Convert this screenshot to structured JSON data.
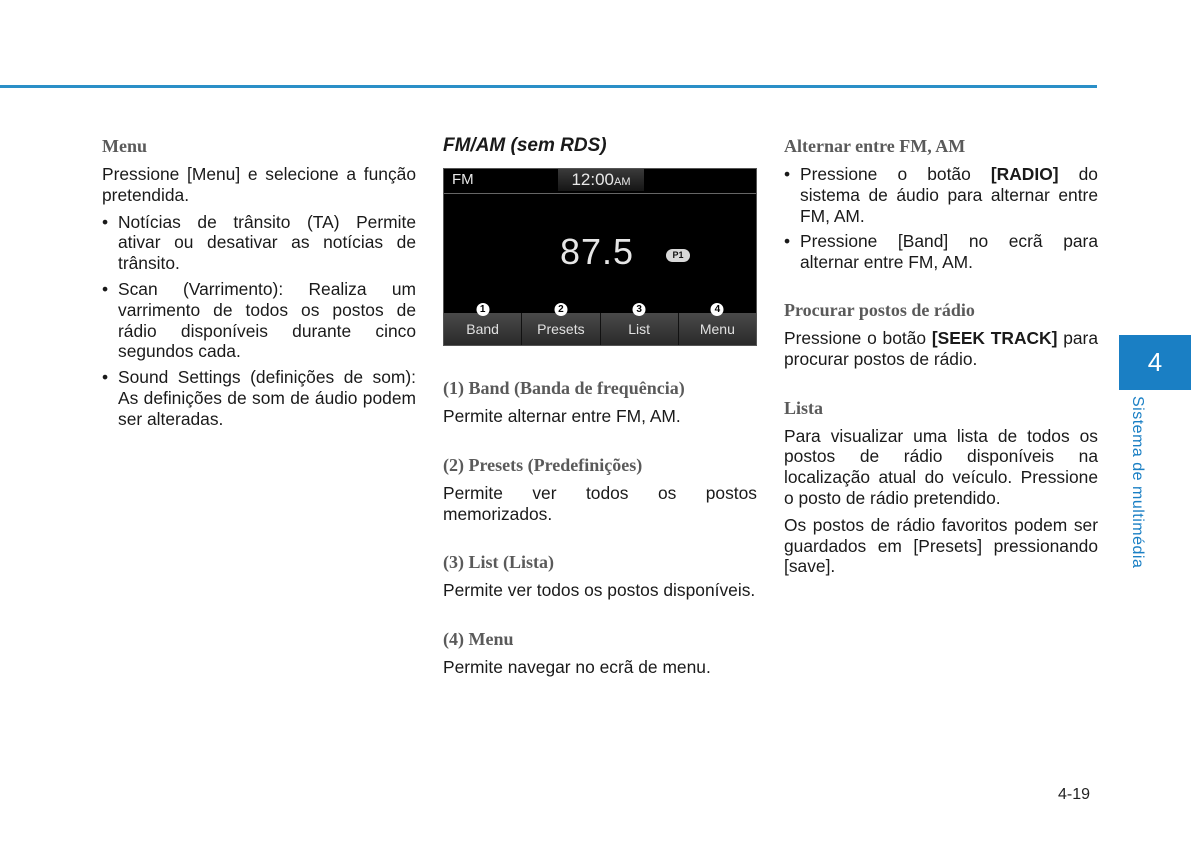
{
  "colors": {
    "accent": "#1a7fc4",
    "rule": "#2a8fc7"
  },
  "left": {
    "heading": "Menu",
    "intro": "Pressione [Menu] e selecione a função pretendida.",
    "bullets": [
      "Notícias de trânsito (TA) Permite ativar ou desativar as notícias de trânsito.",
      "Scan (Varrimento):  Realiza um varrimento de todos os postos de rádio disponíveis durante cinco segundos cada.",
      "Sound Settings (definições de som): As definições de som de áudio podem ser alteradas."
    ]
  },
  "middle": {
    "heading": "FM/AM (sem RDS)",
    "screen": {
      "band": "FM",
      "clock_time": "12:00",
      "clock_ampm": "AM",
      "frequency": "87.5",
      "preset_badge": "P1",
      "softkeys": [
        {
          "number": "1",
          "label": "Band"
        },
        {
          "number": "2",
          "label": "Presets"
        },
        {
          "number": "3",
          "label": "List"
        },
        {
          "number": "4",
          "label": "Menu"
        }
      ]
    },
    "sections": [
      {
        "heading": "(1) Band (Banda de frequência)",
        "text": "Permite alternar entre FM, AM."
      },
      {
        "heading": "(2) Presets (Predefinições)",
        "text": "Permite ver todos os postos memorizados."
      },
      {
        "heading": "(3) List (Lista)",
        "text": "Permite ver todos os postos disponíveis."
      },
      {
        "heading": "(4) Menu",
        "text": "Permite navegar no ecrã de menu."
      }
    ]
  },
  "right": {
    "switch_heading": "Alternar entre FM, AM",
    "switch_bullet1_pre": "Pressione o botão ",
    "switch_bullet1_bold": "[RADIO]",
    "switch_bullet1_post": " do sistema de áudio para alternar entre FM, AM.",
    "switch_bullet2": "Pressione [Band] no ecrã para alternar entre FM, AM.",
    "seek_heading": "Procurar postos de rádio",
    "seek_pre": "Pressione o botão ",
    "seek_bold": "[SEEK TRACK]",
    "seek_post": " para procurar postos de rádio.",
    "list_heading": "Lista",
    "list_text1": "Para visualizar uma lista de todos os postos de rádio disponíveis na localização atual do veículo. Pressione o posto de rádio pretendido.",
    "list_text2": "Os postos de rádio favoritos podem ser guardados em [Presets] pressionando [save]."
  },
  "chapter": {
    "number": "4",
    "title": "Sistema de multimédia"
  },
  "page_number": "4-19"
}
